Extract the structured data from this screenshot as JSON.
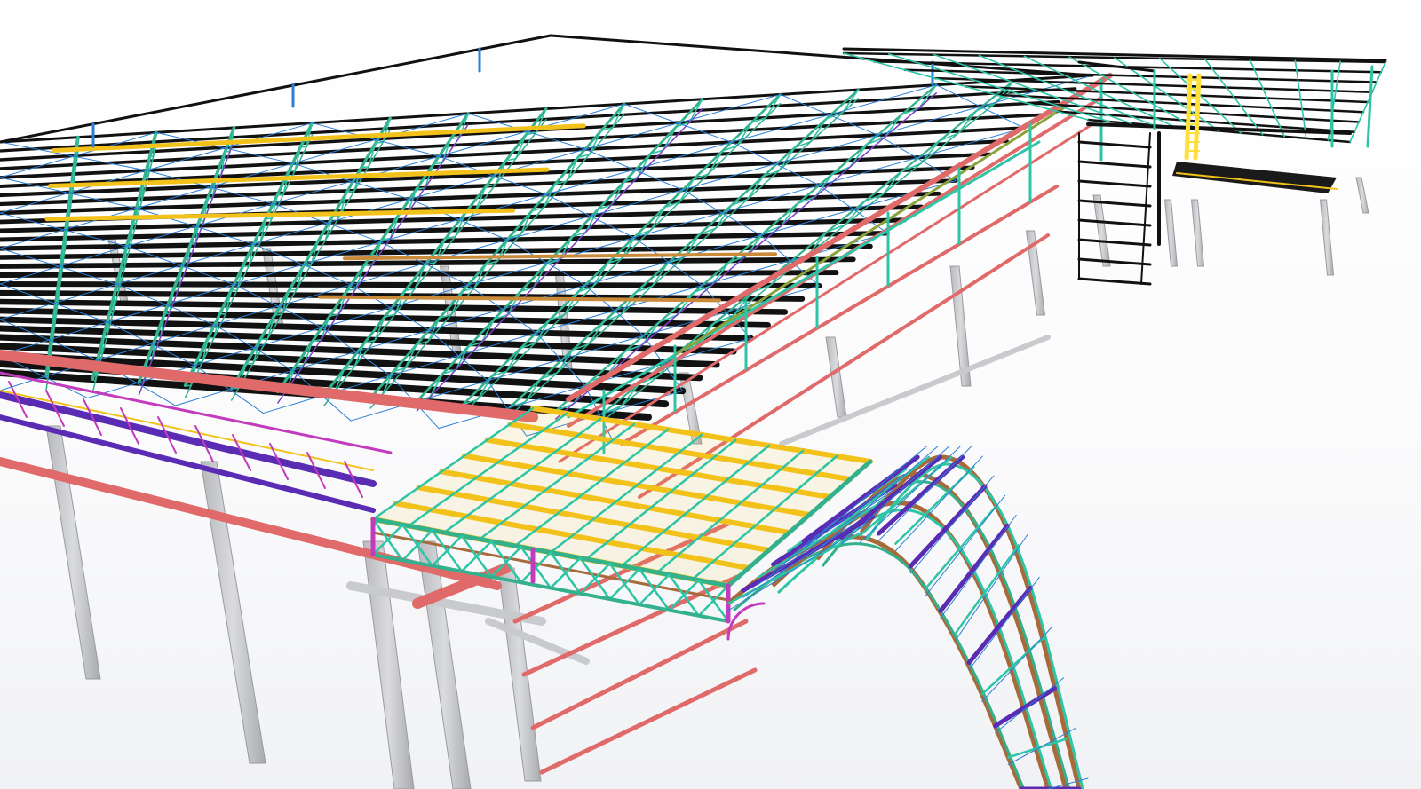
{
  "scene": {
    "description_visible_text": "",
    "palette": {
      "background": "#ffffff",
      "column": "#c9cacd",
      "column_edge": "#9a9ba0",
      "purlin": "#111111",
      "truss_web": "#2ec4a6",
      "truss_chord": "#33b08c",
      "bracing": "#2b7fd6",
      "tie": "#7a3fc4",
      "beam_yellow": "#f2c21b",
      "beam_red": "#e06a6a",
      "beam_orange": "#c98a3a",
      "purple_chord": "#5a2bb3",
      "magenta": "#c23bbd",
      "olive": "#8aa23a",
      "brown_arch": "#a86a3a",
      "stair": "#ffe03a"
    },
    "icons": []
  }
}
